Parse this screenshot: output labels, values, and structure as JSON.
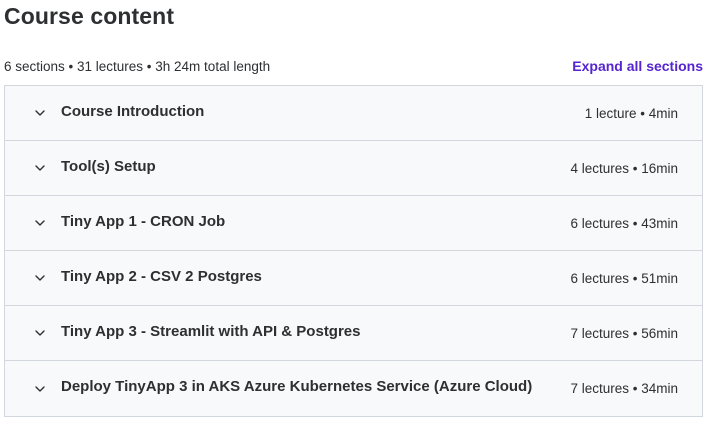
{
  "header": {
    "title": "Course content",
    "summary": "6 sections • 31 lectures • 3h 24m total length",
    "expand_label": "Expand all sections"
  },
  "sections": [
    {
      "title": "Course Introduction",
      "meta": "1 lecture • 4min"
    },
    {
      "title": "Tool(s) Setup",
      "meta": "4 lectures • 16min"
    },
    {
      "title": "Tiny App 1 - CRON Job",
      "meta": "6 lectures • 43min"
    },
    {
      "title": "Tiny App 2 - CSV 2 Postgres",
      "meta": "6 lectures • 51min"
    },
    {
      "title": "Tiny App 3 - Streamlit with API & Postgres",
      "meta": "7 lectures • 56min"
    },
    {
      "title": "Deploy TinyApp 3 in AKS Azure Kubernetes Service (Azure Cloud)",
      "meta": "7 lectures • 34min"
    }
  ],
  "icons": {
    "chevron": "chevron-down-icon"
  },
  "colors": {
    "accent": "#5624d0",
    "row_bg": "#f7f9fa",
    "border": "#d1d7dc",
    "text": "#2d2f31"
  }
}
